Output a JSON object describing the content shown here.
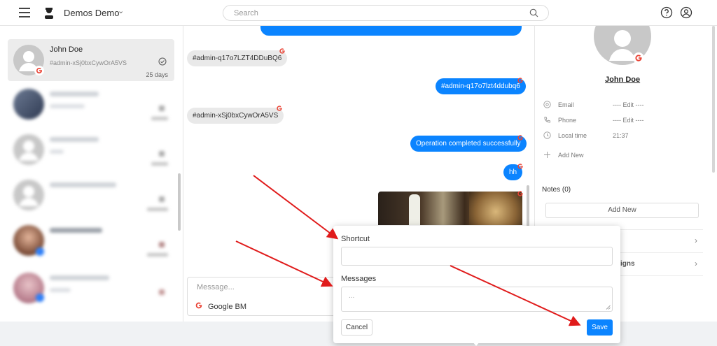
{
  "header": {
    "brand_name": "Demos Demo",
    "search_placeholder": "Search"
  },
  "conversations": [
    {
      "name": "John Doe",
      "sub": "#admin-xSj0bxCywOrA5VS",
      "meta": "25 days",
      "active": true
    },
    {
      "name": "",
      "sub": "",
      "meta": "",
      "blurred": true
    },
    {
      "name": "",
      "sub": "",
      "meta": "",
      "blurred": true
    },
    {
      "name": "",
      "sub": "",
      "meta": "",
      "blurred": true
    },
    {
      "name": "",
      "sub": "",
      "meta": "",
      "blurred": true
    },
    {
      "name": "",
      "sub": "",
      "meta": "",
      "blurred": true
    }
  ],
  "chat": {
    "messages": [
      {
        "dir": "in",
        "text": "#admin-q17o7LZT4DDuBQ6"
      },
      {
        "dir": "out",
        "text": "#admin-q17o7lzt4ddubq6"
      },
      {
        "dir": "in",
        "text": "#admin-xSj0bxCywOrA5VS"
      },
      {
        "dir": "out",
        "text": "Operation completed successfully"
      },
      {
        "dir": "out",
        "text": "hh"
      }
    ],
    "composer_placeholder": "Message...",
    "channel": "Google BM"
  },
  "contact": {
    "name": "John Doe",
    "fields": [
      {
        "label": "Email",
        "value": "---- Edit ----",
        "icon": "at-icon"
      },
      {
        "label": "Phone",
        "value": "---- Edit ----",
        "icon": "phone-icon"
      },
      {
        "label": "Local time",
        "value": "21:37",
        "icon": "clock-icon"
      },
      {
        "label": "Add New",
        "value": "",
        "icon": "plus-icon"
      }
    ],
    "notes_label": "Notes (0)",
    "add_note": "Add New",
    "sections": [
      {
        "title": ""
      },
      {
        "title": "igns"
      }
    ]
  },
  "popup": {
    "shortcut_label": "Shortcut",
    "messages_label": "Messages",
    "messages_placeholder": "...",
    "cancel": "Cancel",
    "save": "Save"
  },
  "colors": {
    "accent": "#0b84ff",
    "annotation_arrow": "#e01b1b",
    "google_red": "#ea4335"
  }
}
